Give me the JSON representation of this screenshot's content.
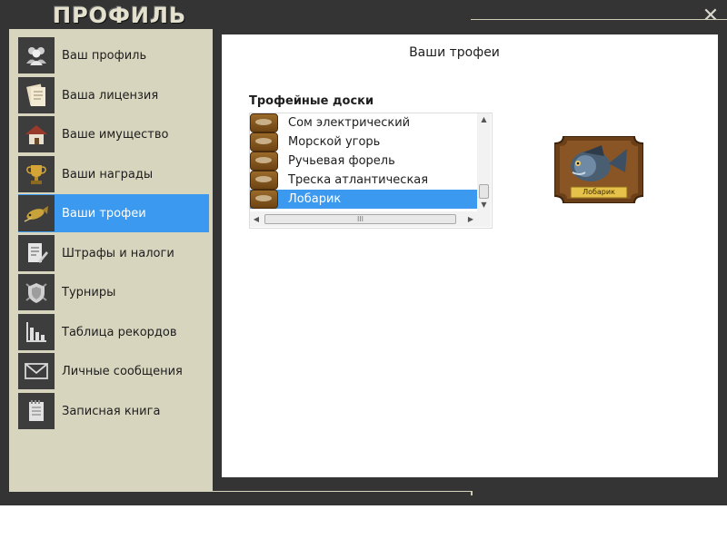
{
  "window": {
    "title": "ПРОФИЛЬ",
    "close_icon": "close-icon"
  },
  "colors": {
    "frame": "#343434",
    "panel": "#d8d5bf",
    "accent": "#3b9af0",
    "content": "#ffffff"
  },
  "sidebar": {
    "items": [
      {
        "label": "Ваш профиль",
        "icon": "users-icon",
        "active": false
      },
      {
        "label": "Ваша лицензия",
        "icon": "license-document-icon",
        "active": false
      },
      {
        "label": "Ваше имущество",
        "icon": "house-icon",
        "active": false
      },
      {
        "label": "Ваши награды",
        "icon": "trophy-cup-icon",
        "active": false
      },
      {
        "label": "Ваши трофеи",
        "icon": "fish-trophy-icon",
        "active": true
      },
      {
        "label": "Штрафы и налоги",
        "icon": "fines-document-icon",
        "active": false
      },
      {
        "label": "Турниры",
        "icon": "tournament-shield-icon",
        "active": false
      },
      {
        "label": "Таблица рекордов",
        "icon": "bar-chart-icon",
        "active": false
      },
      {
        "label": "Личные сообщения",
        "icon": "envelope-icon",
        "active": false
      },
      {
        "label": "Записная книга",
        "icon": "notebook-icon",
        "active": false
      }
    ]
  },
  "main": {
    "title": "Ваши трофеи",
    "list_header": "Трофейные доски",
    "trophies": [
      {
        "label": "Сом электрический",
        "selected": false
      },
      {
        "label": "Морской угорь",
        "selected": false
      },
      {
        "label": "Ручьевая форель",
        "selected": false
      },
      {
        "label": "Треска атлантическая",
        "selected": false
      },
      {
        "label": "Лобарик",
        "selected": true
      }
    ],
    "scrollbar_grip": "III",
    "preview": {
      "name_plate": "Лобарик"
    }
  }
}
